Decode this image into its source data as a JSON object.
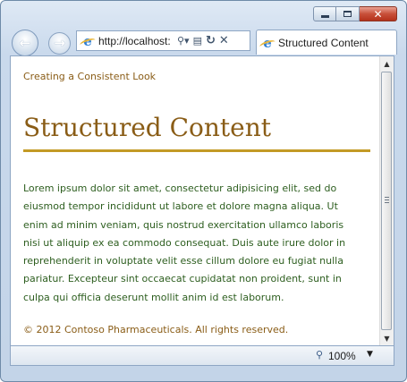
{
  "window": {
    "tab_title": "Structured Content"
  },
  "address_bar": {
    "url": "http://localhost:"
  },
  "page": {
    "site_name": "Creating a Consistent Look",
    "title": "Structured Content",
    "body": "Lorem ipsum dolor sit amet, consectetur adipisicing elit, sed do eiusmod tempor incididunt ut labore et dolore magna aliqua. Ut enim ad minim veniam, quis nostrud exercitation ullamco laboris nisi ut aliquip ex ea commodo consequat. Duis aute irure dolor in reprehenderit in voluptate velit esse cillum dolore eu fugiat nulla pariatur. Excepteur sint occaecat cupidatat non proident, sunt in culpa qui officia deserunt mollit anim id est laborum.",
    "footer": "© 2012 Contoso Pharmaceuticals. All rights reserved."
  },
  "status_bar": {
    "zoom": "100%"
  },
  "icons": [
    "minimize-icon",
    "maximize-icon",
    "close-icon",
    "back-arrow-icon",
    "forward-arrow-icon",
    "ie-logo-icon",
    "search-icon",
    "compatibility-view-icon",
    "refresh-icon",
    "stop-icon",
    "zoom-icon"
  ],
  "colors": {
    "heading": "#8a5d17",
    "rule": "#c39a25",
    "body_text": "#2d5e1f",
    "close_button": "#c8503a"
  }
}
